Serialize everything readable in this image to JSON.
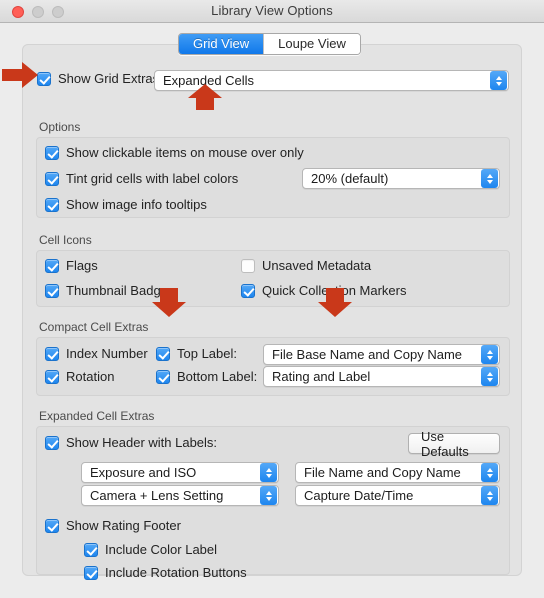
{
  "window": {
    "title": "Library View Options",
    "traffic_lights": [
      "close-button",
      "minimize-button",
      "maximize-button"
    ]
  },
  "tabs": [
    {
      "label": "Grid View",
      "active": true
    },
    {
      "label": "Loupe View",
      "active": false
    }
  ],
  "top_row": {
    "show_grid_extras_label": "Show Grid Extras:",
    "show_grid_extras_checked": true,
    "grid_extras_value": "Expanded Cells"
  },
  "options": {
    "title": "Options",
    "items": [
      {
        "label": "Show clickable items on mouse over only",
        "checked": true
      },
      {
        "label": "Tint grid cells with label colors",
        "checked": true
      },
      {
        "label": "Show image info tooltips",
        "checked": true
      }
    ],
    "tint_amount_value": "20% (default)"
  },
  "cell_icons": {
    "title": "Cell Icons",
    "items": [
      {
        "label": "Flags",
        "checked": true
      },
      {
        "label": "Unsaved Metadata",
        "checked": false
      },
      {
        "label": "Thumbnail Badges",
        "checked": true
      },
      {
        "label": "Quick Collection Markers",
        "checked": true
      }
    ]
  },
  "compact_cell_extras": {
    "title": "Compact Cell Extras",
    "index_number": {
      "label": "Index Number",
      "checked": true
    },
    "rotation": {
      "label": "Rotation",
      "checked": true
    },
    "top_label": {
      "label": "Top Label:",
      "checked": true,
      "value": "File Base Name and Copy Name"
    },
    "bottom_label": {
      "label": "Bottom Label:",
      "checked": true,
      "value": "Rating and Label"
    }
  },
  "expanded_cell_extras": {
    "title": "Expanded Cell Extras",
    "show_header": {
      "label": "Show Header with Labels:",
      "checked": true
    },
    "use_defaults_label": "Use Defaults",
    "header_fields": {
      "top_left": "Exposure and ISO",
      "top_right": "File Name and Copy Name",
      "bottom_left": "Camera + Lens Setting",
      "bottom_right": "Capture Date/Time"
    },
    "show_rating_footer": {
      "label": "Show Rating Footer",
      "checked": true
    },
    "include_color_label": {
      "label": "Include Color Label",
      "checked": true
    },
    "include_rotation_buttons": {
      "label": "Include Rotation Buttons",
      "checked": true
    }
  },
  "annotations": [
    {
      "name": "arrow-show-grid-extras-checkbox",
      "direction": "right"
    },
    {
      "name": "arrow-grid-extras-popup",
      "direction": "up"
    },
    {
      "name": "arrow-top-label-checkbox",
      "direction": "down"
    },
    {
      "name": "arrow-top-label-popup",
      "direction": "down"
    }
  ],
  "colors": {
    "accent_blue": "#1e86ef",
    "annotation_red": "#c9381a",
    "window_background": "#ececec",
    "panel_background": "#e3e3e3",
    "group_background": "#dedede"
  }
}
